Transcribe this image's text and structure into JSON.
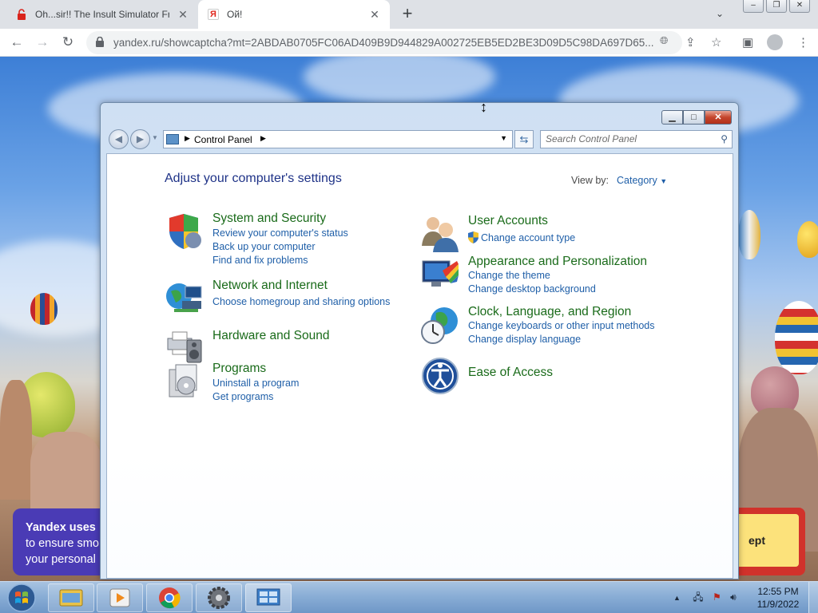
{
  "browser": {
    "tabs": [
      {
        "title": "Oh...sir!! The Insult Simulator Free"
      },
      {
        "title": "Ой!"
      }
    ],
    "url": "yandex.ru/showcaptcha?mt=2ABDAB0705FC06AD409B9D944829A002725EB5ED2BE3D09D5C98DA697D65..."
  },
  "page": {
    "cookie_text_1": "Yandex uses",
    "cookie_text_2": "to ensure smo",
    "cookie_text_3": "your personal",
    "accept_label": "ept"
  },
  "control_panel": {
    "breadcrumb": "Control Panel",
    "search_placeholder": "Search Control Panel",
    "heading": "Adjust your computer's settings",
    "view_by_label": "View by:",
    "view_by_value": "Category",
    "categories": [
      {
        "title": "System and Security",
        "links": [
          "Review your computer's status",
          "Back up your computer",
          "Find and fix problems"
        ]
      },
      {
        "title": "Network and Internet",
        "links": [
          "Choose homegroup and sharing options"
        ]
      },
      {
        "title": "Hardware and Sound",
        "links": []
      },
      {
        "title": "Programs",
        "links": [
          "Uninstall a program",
          "Get programs"
        ]
      },
      {
        "title": "User Accounts",
        "links": [
          "Change account type"
        ]
      },
      {
        "title": "Appearance and Personalization",
        "links": [
          "Change the theme",
          "Change desktop background"
        ]
      },
      {
        "title": "Clock, Language, and Region",
        "links": [
          "Change keyboards or other input methods",
          "Change display language"
        ]
      },
      {
        "title": "Ease of Access",
        "links": []
      }
    ]
  },
  "taskbar": {
    "time": "12:55 PM",
    "date": "11/9/2022"
  },
  "colors": {
    "category_title": "#1a6b1a",
    "link": "#1f5fa8",
    "heading": "#1e3287",
    "cookie_bg": "#4a3bb5",
    "accept_bg": "#fce27b"
  }
}
